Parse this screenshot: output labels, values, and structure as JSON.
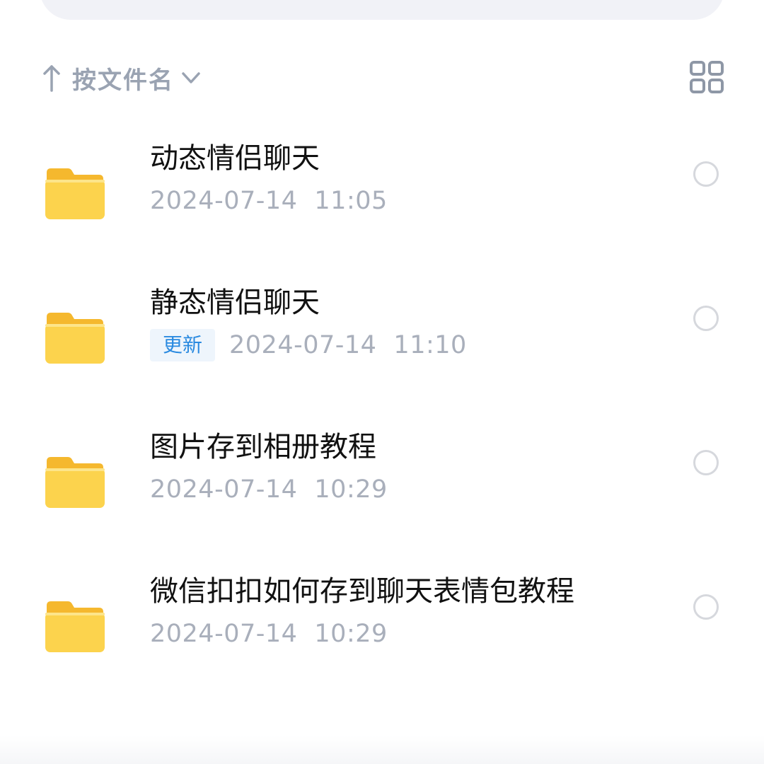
{
  "sort": {
    "label": "按文件名",
    "arrow_icon": "arrow-up-icon",
    "chevron_icon": "chevron-down-icon"
  },
  "view_toggle": {
    "icon": "grid-view-icon"
  },
  "colors": {
    "folder": "#fcd34d",
    "folder_tab": "#f5b82e",
    "badge_text": "#2a8ae0",
    "meta_text": "#a9afbb",
    "sort_text": "#9aa3b2"
  },
  "files": [
    {
      "name": "动态情侣聊天",
      "badge": "",
      "date": "2024-07-14",
      "time": "11:05",
      "icon": "folder-icon"
    },
    {
      "name": "静态情侣聊天",
      "badge": "更新",
      "date": "2024-07-14",
      "time": "11:10",
      "icon": "folder-icon"
    },
    {
      "name": "图片存到相册教程",
      "badge": "",
      "date": "2024-07-14",
      "time": "10:29",
      "icon": "folder-icon"
    },
    {
      "name": "微信扣扣如何存到聊天表情包教程",
      "badge": "",
      "date": "2024-07-14",
      "time": "10:29",
      "icon": "folder-icon"
    }
  ]
}
